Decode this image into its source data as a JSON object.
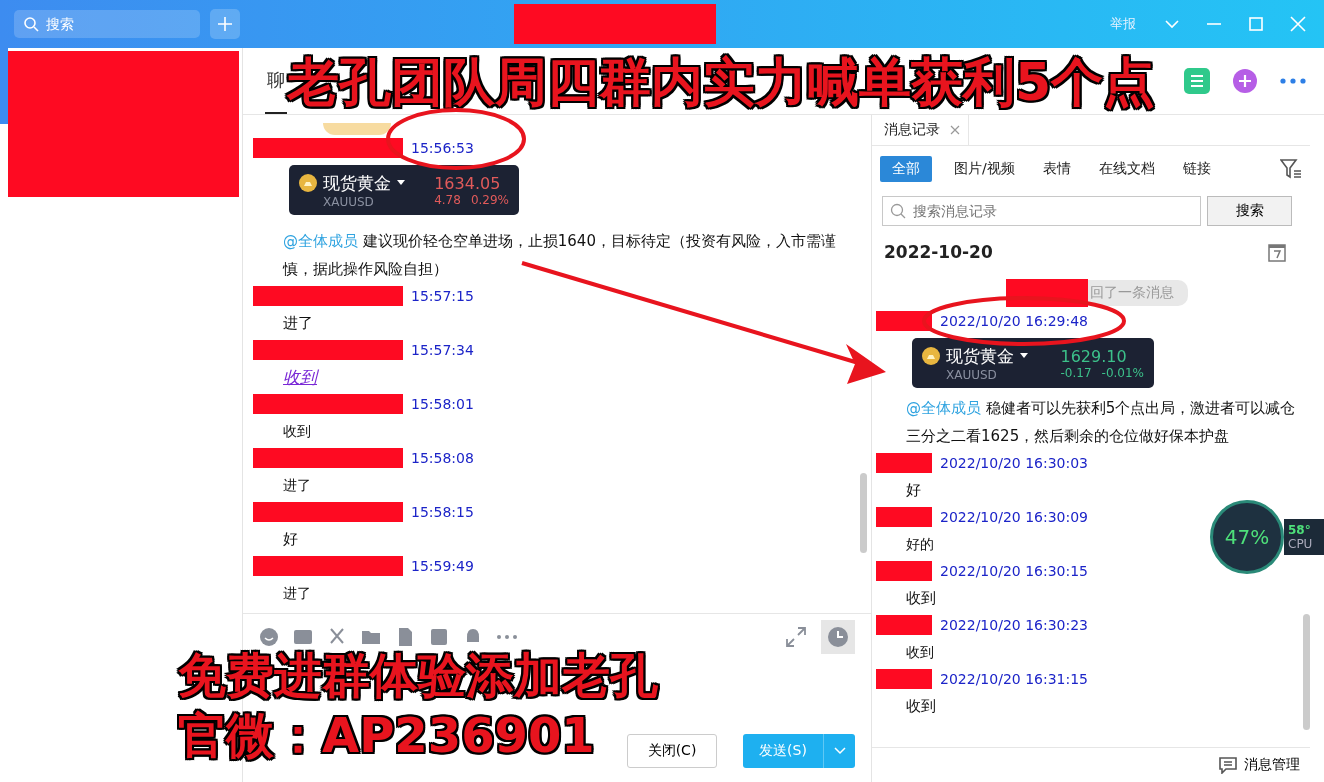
{
  "title_bar": {
    "search": {
      "placeholder": "搜索"
    },
    "report": "举报"
  },
  "chat": {
    "tabs": [
      {
        "label": "聊",
        "selected": true
      }
    ],
    "messages": [
      {
        "time": "15:56:53",
        "card": {
          "name": "现货黄金",
          "symbol": "XAUUSD",
          "price": "1634.05",
          "change": "4.78",
          "percent": "0.29%",
          "color": "#e05a5a"
        },
        "mention": "@全体成员",
        "text": "建议现价轻仓空单进场，止损1640，目标待定（投资有风险，入市需谨慎，据此操作风险自担）",
        "kind": "text"
      },
      {
        "time": "15:57:15",
        "text": "进了",
        "kind": "text"
      },
      {
        "time": "15:57:34",
        "text": "收到",
        "kind": "link"
      },
      {
        "time": "15:58:01",
        "text": "收到",
        "kind": "small"
      },
      {
        "time": "15:58:08",
        "text": "进了",
        "kind": "small"
      },
      {
        "time": "15:58:15",
        "text": "好",
        "kind": "text"
      },
      {
        "time": "15:59:49",
        "text": "进了",
        "kind": "small"
      }
    ],
    "buttons": {
      "close": "关闭(C)",
      "send": "发送(S)"
    }
  },
  "history": {
    "tab": "消息记录",
    "filters": [
      {
        "label": "全部",
        "selected": true
      },
      {
        "label": "图片/视频",
        "selected": false
      },
      {
        "label": "表情",
        "selected": false
      },
      {
        "label": "在线文档",
        "selected": false
      },
      {
        "label": "链接",
        "selected": false
      }
    ],
    "search": {
      "placeholder": "搜索消息记录",
      "button": "搜索"
    },
    "date": "2022-10-20",
    "notice": "回了一条消息",
    "messages": [
      {
        "time": "2022/10/20 16:29:48",
        "card": {
          "name": "现货黄金",
          "symbol": "XAUUSD",
          "price": "1629.10",
          "change": "-0.17",
          "percent": "-0.01%",
          "color": "#3cc08a"
        },
        "mention": "@全体成员",
        "text": "稳健者可以先获利5个点出局，激进者可以减仓三分之二看1625，然后剩余的仓位做好保本护盘",
        "kind": "text"
      },
      {
        "time": "2022/10/20 16:30:03",
        "text": "好",
        "kind": "text"
      },
      {
        "time": "2022/10/20 16:30:09",
        "text": "好的",
        "kind": "small"
      },
      {
        "time": "2022/10/20 16:30:15",
        "text": "收到",
        "kind": "text"
      },
      {
        "time": "2022/10/20 16:30:23",
        "text": "收到",
        "kind": "small"
      },
      {
        "time": "2022/10/20 16:31:15",
        "text": "收到",
        "kind": "text"
      }
    ],
    "footer": "消息管理"
  },
  "cpu_widget": {
    "load": "47%",
    "temperature": "58°",
    "label": "CPU"
  },
  "annotations": {
    "headline": "老孔团队周四群内实力喊单获利5个点",
    "footer": [
      "免费进群体验添加老孔",
      "官微：AP236901"
    ]
  }
}
